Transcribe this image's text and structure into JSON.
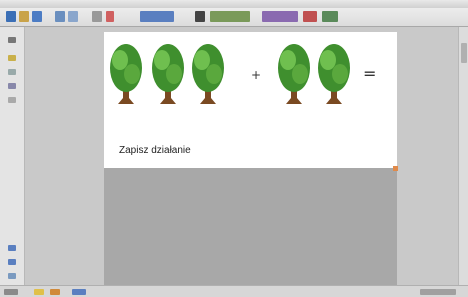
{
  "toolbar": {
    "icons": [
      "new-icon",
      "open-icon",
      "save-icon",
      "undo-icon",
      "redo-icon",
      "print-icon",
      "zoom-icon",
      "pen-icon",
      "line-icon",
      "eraser-icon",
      "text-icon",
      "color-icon"
    ]
  },
  "slide": {
    "left_tree_count": 3,
    "right_tree_count": 2,
    "plus_sign": "+",
    "equals_sign": "=",
    "caption": "Zapisz działanie"
  },
  "colors": {
    "tree_foliage": "#3f8f2e",
    "tree_foliage_light": "#6fbf4f",
    "tree_trunk": "#7a4a22",
    "canvas_gray": "#a8a8a8"
  }
}
